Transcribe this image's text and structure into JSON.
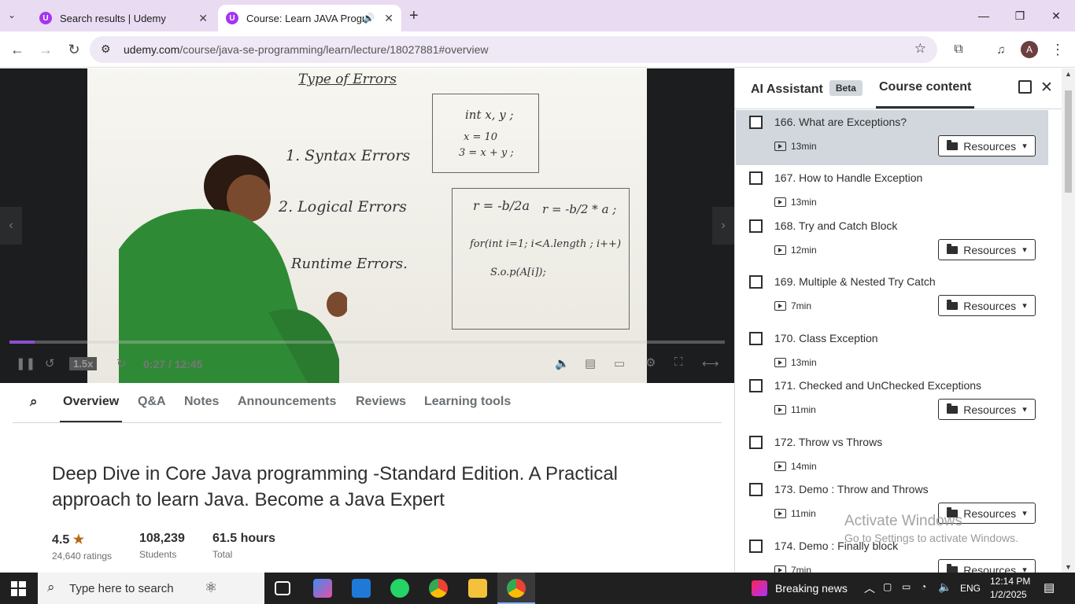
{
  "browser": {
    "tabs": [
      {
        "title": "Search results | Udemy"
      },
      {
        "title": "Course: Learn JAVA Program"
      }
    ],
    "url_host": "udemy.com",
    "url_path": "/course/java-se-programming/learn/lecture/18027881#overview",
    "profile_initial": "A"
  },
  "video": {
    "board": {
      "title": "Type of Errors",
      "e1": "1. Syntax Errors",
      "e2": "2. Logical Errors",
      "e3": "3. Runtime Errors.",
      "code1": "int x, y ;",
      "code2": "x = 10",
      "code3": "3 = x + y ;",
      "code4": "r = -b/2a",
      "code5": "r = -b/2 * a ;",
      "code6": "for(int i=1; i<A.length ; i++)",
      "code7": "S.o.p(A[i]);"
    },
    "time": "0:27 / 12:45",
    "speed": "1.5x",
    "progress": 0.035
  },
  "course_tabs": [
    "Overview",
    "Q&A",
    "Notes",
    "Announcements",
    "Reviews",
    "Learning tools"
  ],
  "course": {
    "title": "Deep Dive in Core Java programming -Standard Edition. A Practical approach to learn Java. Become a Java Expert",
    "rating": "4.5",
    "ratings_count": "24,640 ratings",
    "students": "108,239",
    "students_label": "Students",
    "hours": "61.5 hours",
    "hours_label": "Total"
  },
  "sidebar": {
    "ai_tab": "AI Assistant",
    "beta": "Beta",
    "content_tab": "Course content",
    "resources_label": "Resources",
    "items": [
      {
        "title": "166. What are Exceptions?",
        "duration": "13min"
      },
      {
        "title": "167. How to Handle Exception",
        "duration": "13min"
      },
      {
        "title": "168. Try and Catch Block",
        "duration": "12min"
      },
      {
        "title": "169. Multiple & Nested Try Catch",
        "duration": "7min"
      },
      {
        "title": "170. Class Exception",
        "duration": "13min"
      },
      {
        "title": "171. Checked and UnChecked Exceptions",
        "duration": "11min"
      },
      {
        "title": "172. Throw vs Throws",
        "duration": "14min"
      },
      {
        "title": "173. Demo : Throw and Throws",
        "duration": "11min"
      },
      {
        "title": "174. Demo : Finally block",
        "duration": "7min"
      }
    ]
  },
  "watermark": {
    "line1": "Activate Windows",
    "line2": "Go to Settings to activate Windows."
  },
  "taskbar": {
    "search_placeholder": "Type here to search",
    "news": "Breaking news",
    "lang": "ENG",
    "time": "12:14 PM",
    "date": "1/2/2025"
  }
}
